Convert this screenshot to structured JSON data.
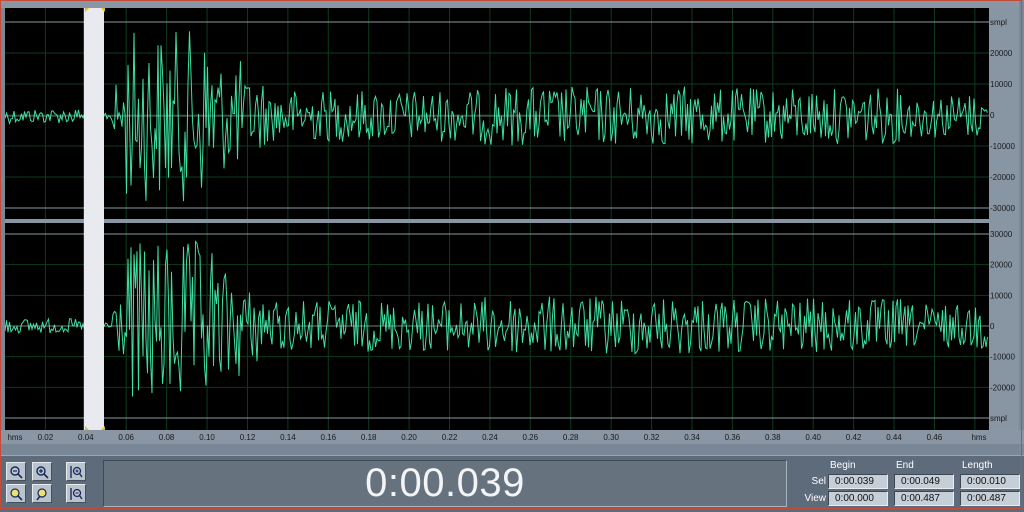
{
  "channels": [
    {
      "scale_labels": [
        "smpl",
        "20000",
        "10000",
        "0",
        "-10000",
        "-20000",
        "-30000"
      ]
    },
    {
      "scale_labels": [
        "30000",
        "20000",
        "10000",
        "0",
        "-10000",
        "-20000",
        "smpl"
      ]
    }
  ],
  "time_ruler": {
    "unit_left": "hms",
    "unit_right": "hms",
    "ticks": [
      "0.02",
      "0.04",
      "0.06",
      "0.08",
      "0.10",
      "0.12",
      "0.14",
      "0.16",
      "0.18",
      "0.20",
      "0.22",
      "0.24",
      "0.26",
      "0.28",
      "0.30",
      "0.32",
      "0.34",
      "0.36",
      "0.38",
      "0.40",
      "0.42",
      "0.44",
      "0.46"
    ]
  },
  "time_display": "0:00.039",
  "selection_panel": {
    "col_begin": "Begin",
    "col_end": "End",
    "col_length": "Length",
    "sel_label": "Sel",
    "view_label": "View",
    "sel": {
      "begin": "0:00.039",
      "end": "0:00.049",
      "length": "0:00.010"
    },
    "view": {
      "begin": "0:00.000",
      "end": "0:00.487",
      "length": "0:00.487"
    }
  },
  "toolbar": {
    "buttons": [
      "zoom-out-full-icon",
      "zoom-in-icon",
      "zoom-in-vertical-icon",
      "zoom-to-left-icon",
      "zoom-to-right-icon",
      "zoom-out-vertical-icon"
    ]
  },
  "colors": {
    "waveform": "#3de0a0",
    "background": "#000000",
    "selection": "#e8eaf0",
    "grid": "#0e3a1e",
    "panel": "#5e6b7a"
  },
  "waveform": {
    "sample_rate_view": "0:00.487",
    "selection_start_s": 0.039,
    "selection_end_s": 0.049
  }
}
